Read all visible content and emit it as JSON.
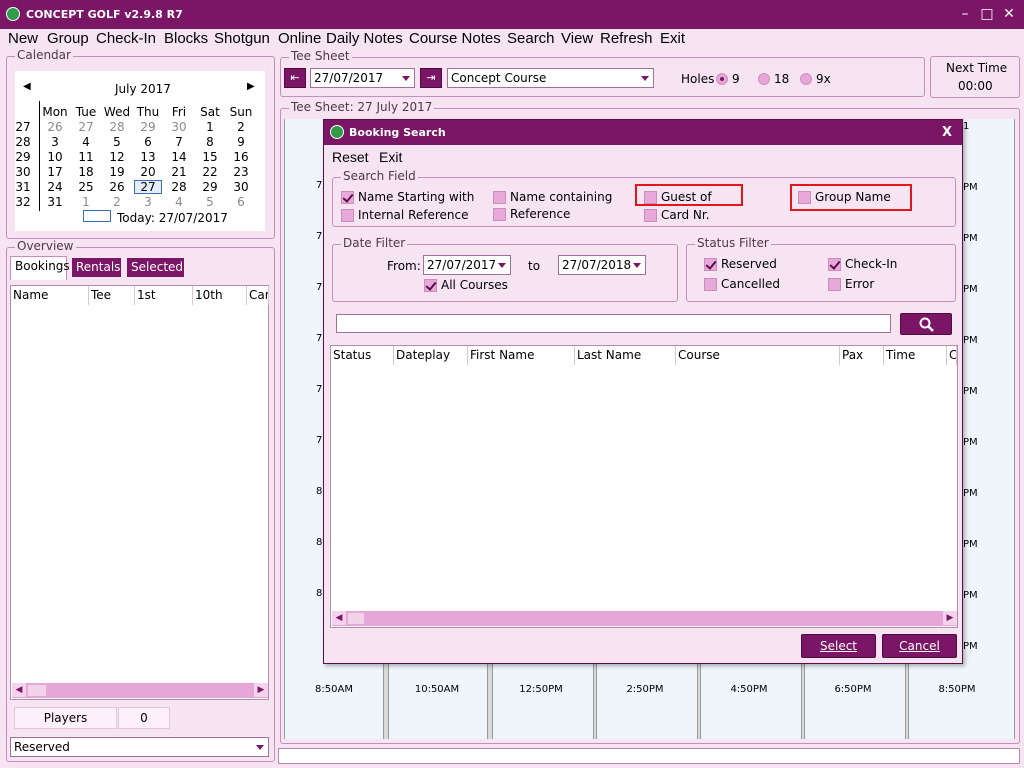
{
  "window": {
    "title": "CONCEPT GOLF v2.9.8 R7",
    "minimize": "–",
    "maximize": "□",
    "close": "✕"
  },
  "menu": [
    "New",
    "Group",
    "Check-In",
    "Blocks",
    "Shotgun",
    "Online",
    "Daily Notes",
    "Course Notes",
    "Search",
    "View",
    "Refresh",
    "Exit"
  ],
  "calendar": {
    "legend": "Calendar",
    "month": "July 2017",
    "days": [
      "Mon",
      "Tue",
      "Wed",
      "Thu",
      "Fri",
      "Sat",
      "Sun"
    ],
    "weeks": [
      {
        "wk": "27",
        "d": [
          "26",
          "27",
          "28",
          "29",
          "30",
          "1",
          "2"
        ]
      },
      {
        "wk": "28",
        "d": [
          "3",
          "4",
          "5",
          "6",
          "7",
          "8",
          "9"
        ]
      },
      {
        "wk": "29",
        "d": [
          "10",
          "11",
          "12",
          "13",
          "14",
          "15",
          "16"
        ]
      },
      {
        "wk": "30",
        "d": [
          "17",
          "18",
          "19",
          "20",
          "21",
          "22",
          "23"
        ]
      },
      {
        "wk": "31",
        "d": [
          "24",
          "25",
          "26",
          "27",
          "28",
          "29",
          "30"
        ]
      },
      {
        "wk": "32",
        "d": [
          "31",
          "1",
          "2",
          "3",
          "4",
          "5",
          "6"
        ]
      }
    ],
    "today": "Today: 27/07/2017"
  },
  "overview": {
    "legend": "Overview",
    "tabs": [
      "Bookings",
      "Rentals",
      "Selected"
    ],
    "columns": [
      "Name",
      "Tee",
      "1st",
      "10th",
      "Car"
    ],
    "players_label": "Players",
    "players_count": "0",
    "status_value": "Reserved"
  },
  "teesheet": {
    "legend": "Tee Sheet",
    "date": "27/07/2017",
    "course": "Concept Course",
    "holes_label": "Holes",
    "holes_options": [
      "9",
      "18",
      "9x"
    ],
    "next_time_label": "Next Time",
    "next_time_value": "00:00",
    "sheet_legend": "Tee Sheet: 27 July 2017",
    "left_times": [
      "7:",
      "7:",
      "7:",
      "7:",
      "7:",
      "7:",
      "8:",
      "8:",
      "8:"
    ],
    "right_labels": [
      "1",
      "PM",
      "PM",
      "PM",
      "PM",
      "PM",
      "PM",
      "PM",
      "PM",
      "PM",
      "PM"
    ],
    "bottom_times": [
      "8:50AM",
      "10:50AM",
      "12:50PM",
      "2:50PM",
      "4:50PM",
      "6:50PM",
      "8:50PM"
    ]
  },
  "dialog": {
    "title": "Booking Search",
    "close": "X",
    "menu": [
      "Reset",
      "Exit"
    ],
    "search_field": {
      "legend": "Search Field",
      "options": [
        {
          "label": "Name Starting with",
          "checked": true
        },
        {
          "label": "Name containing",
          "checked": false
        },
        {
          "label": "Guest of",
          "checked": false
        },
        {
          "label": "Group Name",
          "checked": false
        },
        {
          "label": "Internal Reference",
          "checked": false
        },
        {
          "label": "Reference",
          "checked": false
        },
        {
          "label": "Card Nr.",
          "checked": false
        }
      ]
    },
    "date_filter": {
      "legend": "Date Filter",
      "from_label": "From:",
      "from": "27/07/2017",
      "to_label": "to",
      "to": "27/07/2018",
      "all_courses": "All Courses"
    },
    "status_filter": {
      "legend": "Status Filter",
      "options": [
        {
          "label": "Reserved",
          "checked": true
        },
        {
          "label": "Check-In",
          "checked": true
        },
        {
          "label": "Cancelled",
          "checked": false
        },
        {
          "label": "Error",
          "checked": false
        }
      ]
    },
    "search_text": "",
    "columns": [
      "Status",
      "Dateplay",
      "First Name",
      "Last Name",
      "Course",
      "Pax",
      "Time",
      "C"
    ],
    "select_btn": "Select",
    "cancel_btn": "Cancel"
  }
}
